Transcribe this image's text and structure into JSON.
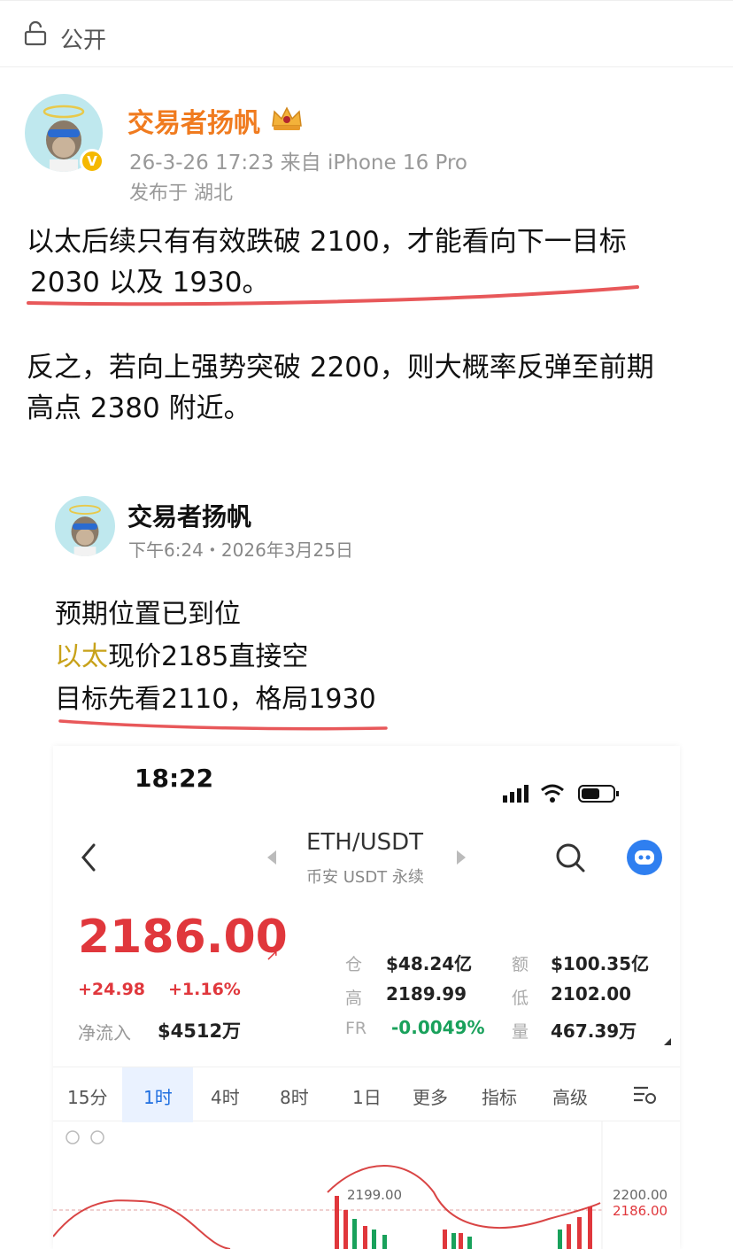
{
  "header": {
    "visibility": "公开",
    "icons": [
      "lock-icon"
    ]
  },
  "post": {
    "author": "交易者扬帆",
    "datetime": "26-3-26 17:23",
    "source": "来自 iPhone 16 Pro",
    "location": "发布于 湖北",
    "text_lines": [
      "以太后续只有有效跌破 2100，才能看向下一目标",
      "2030 以及 1930。",
      "反之，若向上强势突破 2200，则大概率反弹至前期",
      "高点 2380 附近。"
    ],
    "icons": [
      "avatar",
      "verified-badge-icon",
      "crown-icon"
    ],
    "colors": {
      "author": "#f07b1f",
      "underline": "#e8585a"
    }
  },
  "quoted": {
    "author": "交易者扬帆",
    "meta": "下午6:24・2026年3月25日",
    "line1": "预期位置已到位",
    "line2_highlight": "以太",
    "line2_rest": "现价2185直接空",
    "line3": "目标先看2110，格局1930",
    "colors": {
      "highlight": "#c8a21a"
    }
  },
  "screenshot": {
    "time": "18:22",
    "pair": "ETH/USDT",
    "market": "币安 USDT 永续",
    "price": "2186.00",
    "price_arrow": "↗",
    "change": "+24.98",
    "change_pct": "+1.16%",
    "net_inflow_label": "净流入",
    "net_inflow_value": "$4512万",
    "stats": {
      "oi_label": "仓",
      "oi_value": "$48.24亿",
      "amount_label": "额",
      "amount_value": "$100.35亿",
      "high_label": "高",
      "high_value": "2189.99",
      "low_label": "低",
      "low_value": "2102.00",
      "fr_label": "FR",
      "fr_value": "-0.0049%",
      "vol_label": "量",
      "vol_value": "467.39万"
    },
    "tabs": [
      "15分",
      "1时",
      "4时",
      "8时",
      "1日",
      "更多",
      "指标",
      "高级"
    ],
    "active_tab": "1时",
    "chart_labels": {
      "peak": "2199.00",
      "axis_top": "2200.00",
      "axis_current": "2186.00"
    },
    "icons": [
      "back-icon",
      "search-icon",
      "bot-icon",
      "signal-icon",
      "wifi-icon",
      "battery-icon",
      "chart-settings-icon"
    ],
    "colors": {
      "up": "#e0373c",
      "down": "#19a15b",
      "accent": "#1f6fe0"
    }
  }
}
